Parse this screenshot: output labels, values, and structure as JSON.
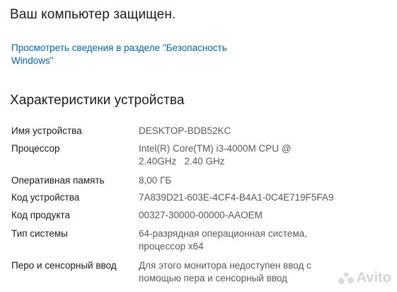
{
  "security": {
    "status": "Ваш компьютер защищен.",
    "link_line1": "Просмотреть сведения в разделе \"Безопасность",
    "link_line2": "Windows\""
  },
  "specs": {
    "title": "Характеристики устройства",
    "rows": [
      {
        "label": "Имя устройства",
        "value": "DESKTOP-BDB52KC"
      },
      {
        "label": "Процессор",
        "value": "Intel(R) Core(TM) i3-4000M CPU @ 2.40GHz   2.40 GHz"
      },
      {
        "label": "Оперативная память",
        "value": "8,00 ГБ"
      },
      {
        "label": "Код устройства",
        "value": "7A839D21-603E-4CF4-B4A1-0C4E719F5FA9"
      },
      {
        "label": "Код продукта",
        "value": "00327-30000-00000-AAOEM"
      },
      {
        "label": "Тип системы",
        "value": "64-разрядная операционная система, процессор x64"
      },
      {
        "label": "Перо и сенсорный ввод",
        "value": "Для этого монитора недоступен ввод с помощью пера и сенсорный ввод"
      }
    ]
  },
  "watermark": {
    "text": "Avito",
    "icon": "avito-dots-icon"
  }
}
